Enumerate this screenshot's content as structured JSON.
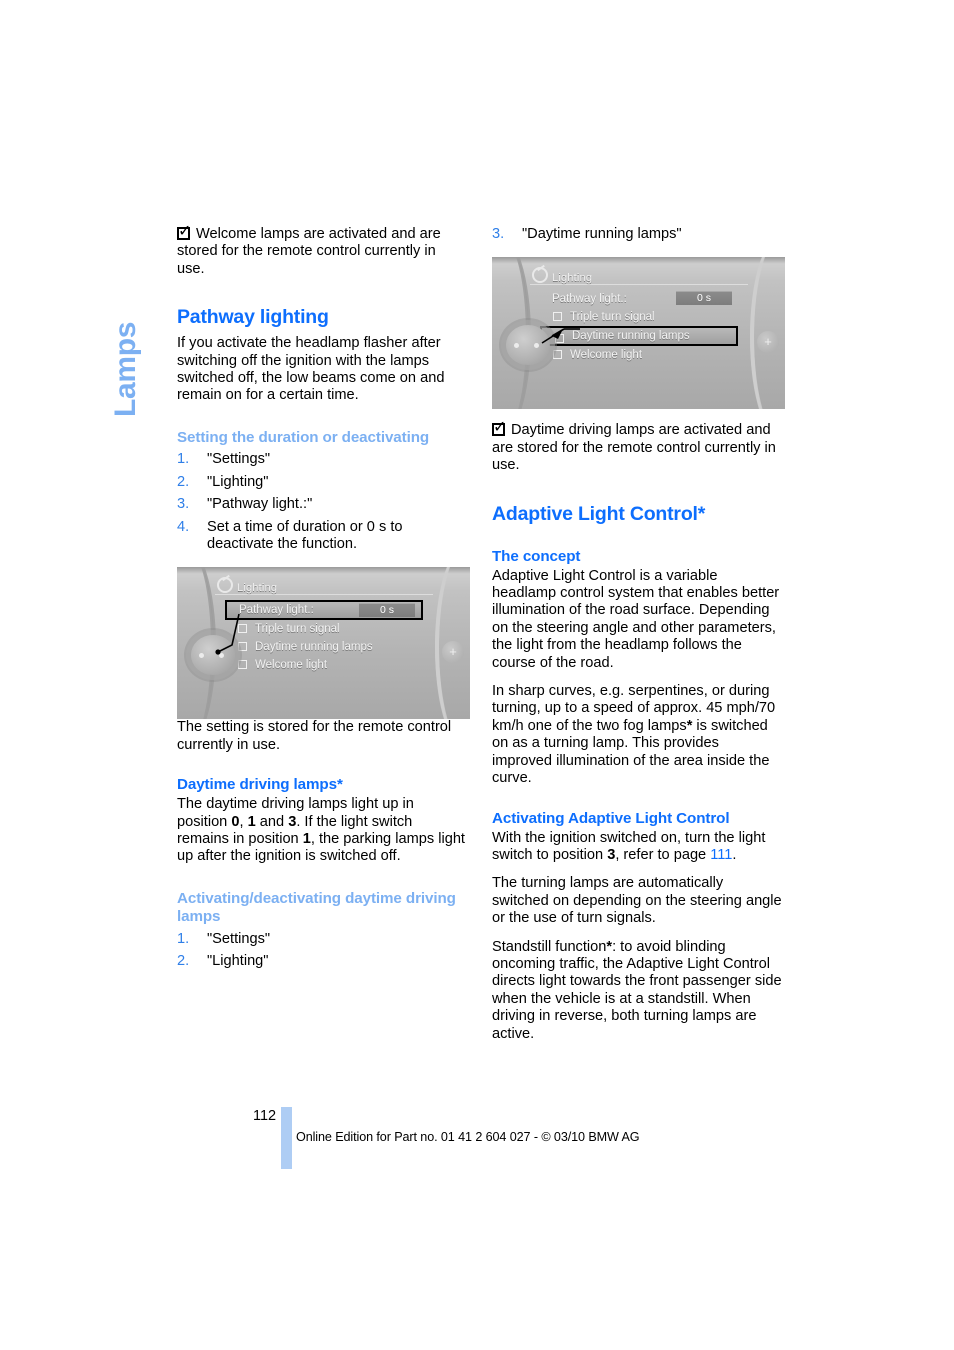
{
  "chapter_tab": "Lamps",
  "left_column": {
    "note_top": {
      "icon": "checked-checkbox-icon",
      "text": "Welcome lamps are activated and are stored for the remote control currently in use."
    },
    "heading_pathway": "Pathway lighting",
    "pathway_body": "If you activate the headlamp flasher after switching off the ignition with the lamps switched off, the low beams come on and remain on for a certain time.",
    "heading_setting_duration": "Setting the duration or deactivating",
    "setting_steps": [
      {
        "num": "1.",
        "text": "\"Settings\""
      },
      {
        "num": "2.",
        "text": "\"Lighting\""
      },
      {
        "num": "3.",
        "text": "\"Pathway light.:\""
      },
      {
        "num": "4.",
        "text": "Set a time of duration or 0 s to deactivate the function."
      }
    ],
    "idrive_1": {
      "header": "Lighting",
      "rows": [
        {
          "label": "Pathway light.:",
          "value": "0 s",
          "checkbox": false,
          "selected": true
        },
        {
          "label": "Triple turn signal",
          "value": "",
          "checkbox": true,
          "selected": false
        },
        {
          "label": "Daytime running lamps",
          "value": "",
          "checkbox": true,
          "selected": false
        },
        {
          "label": "Welcome light",
          "value": "",
          "checkbox": true,
          "selected": false
        }
      ],
      "plus_glyph": "+"
    },
    "caption_1": "The setting is stored for the remote control currently in use.",
    "heading_daytime": "Daytime driving lamps*",
    "daytime_body_parts": {
      "a": "The daytime driving lamps light up in position ",
      "b0": "0",
      "c": ", ",
      "b1": "1",
      "d": " and ",
      "b3": "3",
      "e": ". If the light switch remains in position ",
      "b1b": "1",
      "f": ", the parking lamps light up after the ignition is switched off."
    },
    "heading_activating_daytime": "Activating/deactivating daytime driving lamps",
    "activating_steps": [
      {
        "num": "1.",
        "text": "\"Settings\""
      },
      {
        "num": "2.",
        "text": "\"Lighting\""
      }
    ]
  },
  "right_column": {
    "step_3": {
      "num": "3.",
      "text": "\"Daytime running lamps\""
    },
    "idrive_2": {
      "header": "Lighting",
      "rows": [
        {
          "label": "Pathway light.:",
          "value": "0 s",
          "checkbox": false,
          "selected": false
        },
        {
          "label": "Triple turn signal",
          "value": "",
          "checkbox": true,
          "selected": false
        },
        {
          "label": "Daytime running lamps",
          "value": "",
          "checkbox": true,
          "selected": true
        },
        {
          "label": "Welcome light",
          "value": "",
          "checkbox": true,
          "selected": false
        }
      ],
      "plus_glyph": "+"
    },
    "note_daytime": {
      "icon": "checked-checkbox-icon",
      "text": "Daytime driving lamps are activated and are stored for the remote control currently in use."
    },
    "heading_alc": "Adaptive Light Control*",
    "heading_concept": "The concept",
    "concept_p1": "Adaptive Light Control is a variable headlamp control system that enables better illumination of the road surface. Depending on the steering angle and other parameters, the light from the headlamp follows the course of the road.",
    "concept_p2_parts": {
      "a": "In sharp curves, e.g. serpentines, or during turning, up to a speed of approx. 45 mph/70 km/h one of the two fog lamps",
      "ast": "*",
      "b": " is switched on as a turning lamp. This provides improved illumination of the area inside the curve."
    },
    "heading_activating_alc": "Activating Adaptive Light Control",
    "activating_p1_parts": {
      "a": "With the ignition switched on, turn the light switch to position ",
      "pos": "3",
      "b": ", refer to page ",
      "page_ref": "111",
      "c": "."
    },
    "activating_p2": "The turning lamps are automatically switched on depending on the steering angle or the use of turn signals.",
    "standstill_parts": {
      "a": "Standstill function",
      "ast": "*",
      "b": ": to avoid blinding oncoming traffic, the Adaptive Light Control directs light towards the front passenger side when the vehicle is at a standstill. When driving in reverse, both turning lamps are active."
    }
  },
  "footer": {
    "page_number": "112",
    "text": "Online Edition for Part no. 01 41 2 604 027 - © 03/10 BMW AG"
  },
  "colors": {
    "accent_blue": "#0d6efd",
    "light_blue": "#7cb0f2",
    "step_blue": "#2f7fe8",
    "footer_bar": "#aecdf4"
  }
}
